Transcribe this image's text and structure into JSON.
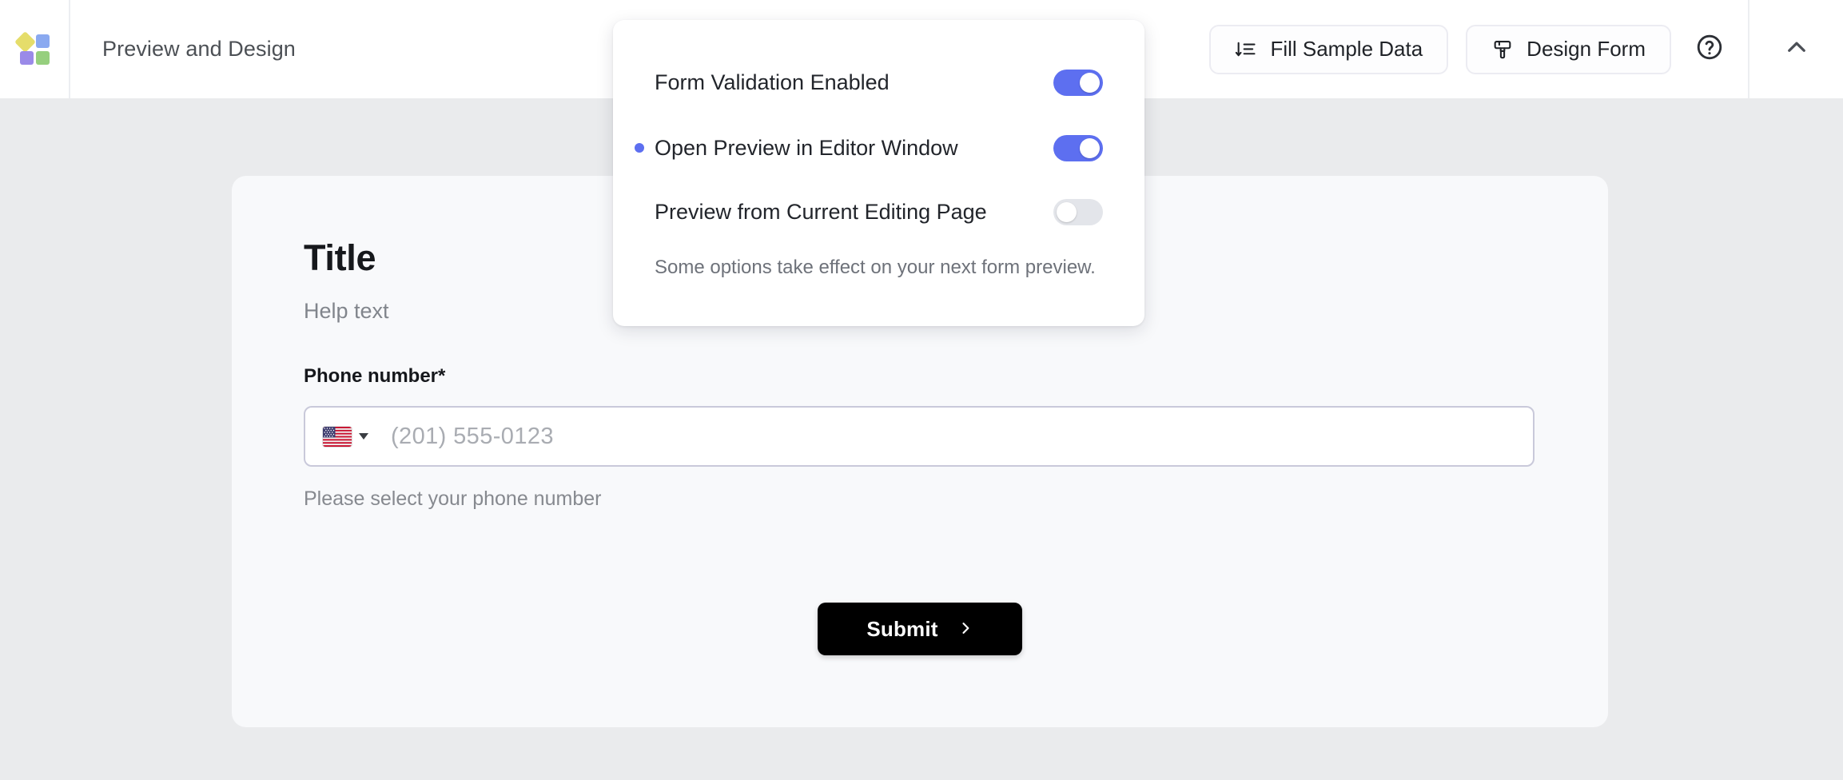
{
  "header": {
    "logo_icon": "app-logo-blocks-icon",
    "logo_colors": {
      "diamond": "#e5dd6a",
      "top_right": "#8aa9f0",
      "bottom_left": "#9a8ae8",
      "bottom_right": "#96cf7e"
    },
    "title": "Preview and Design",
    "buttons": [
      {
        "label": "Fill Sample Data",
        "icon": "sort-descending-icon"
      },
      {
        "label": "Design Form",
        "icon": "paint-brush-icon"
      }
    ],
    "help_icon": "help-circle-icon",
    "collapse_icon": "chevron-up-icon"
  },
  "popup": {
    "options": [
      {
        "label": "Form Validation Enabled",
        "state": "on",
        "bulleted": false
      },
      {
        "label": "Open Preview in Editor Window",
        "state": "on",
        "bulleted": true
      },
      {
        "label": "Preview from Current Editing Page",
        "state": "off",
        "bulleted": false
      }
    ],
    "note": "Some options take effect on your next form preview.",
    "accent_color": "#5d6ff0",
    "toggle_off_color": "#e3e5ea"
  },
  "form": {
    "title": "Title",
    "help_text": "Help text",
    "field": {
      "label": "Phone number*",
      "country_flag": "us-flag-icon",
      "caret_icon": "caret-down-icon",
      "placeholder": "(201) 555-0123",
      "value": "",
      "error": "Please select your phone number"
    },
    "submit": {
      "label": "Submit",
      "icon": "chevron-right-icon",
      "background": "#000000"
    }
  },
  "theme": {
    "page_background": "#eaebed",
    "card_background": "#f8f9fb",
    "header_background": "#ffffff"
  }
}
